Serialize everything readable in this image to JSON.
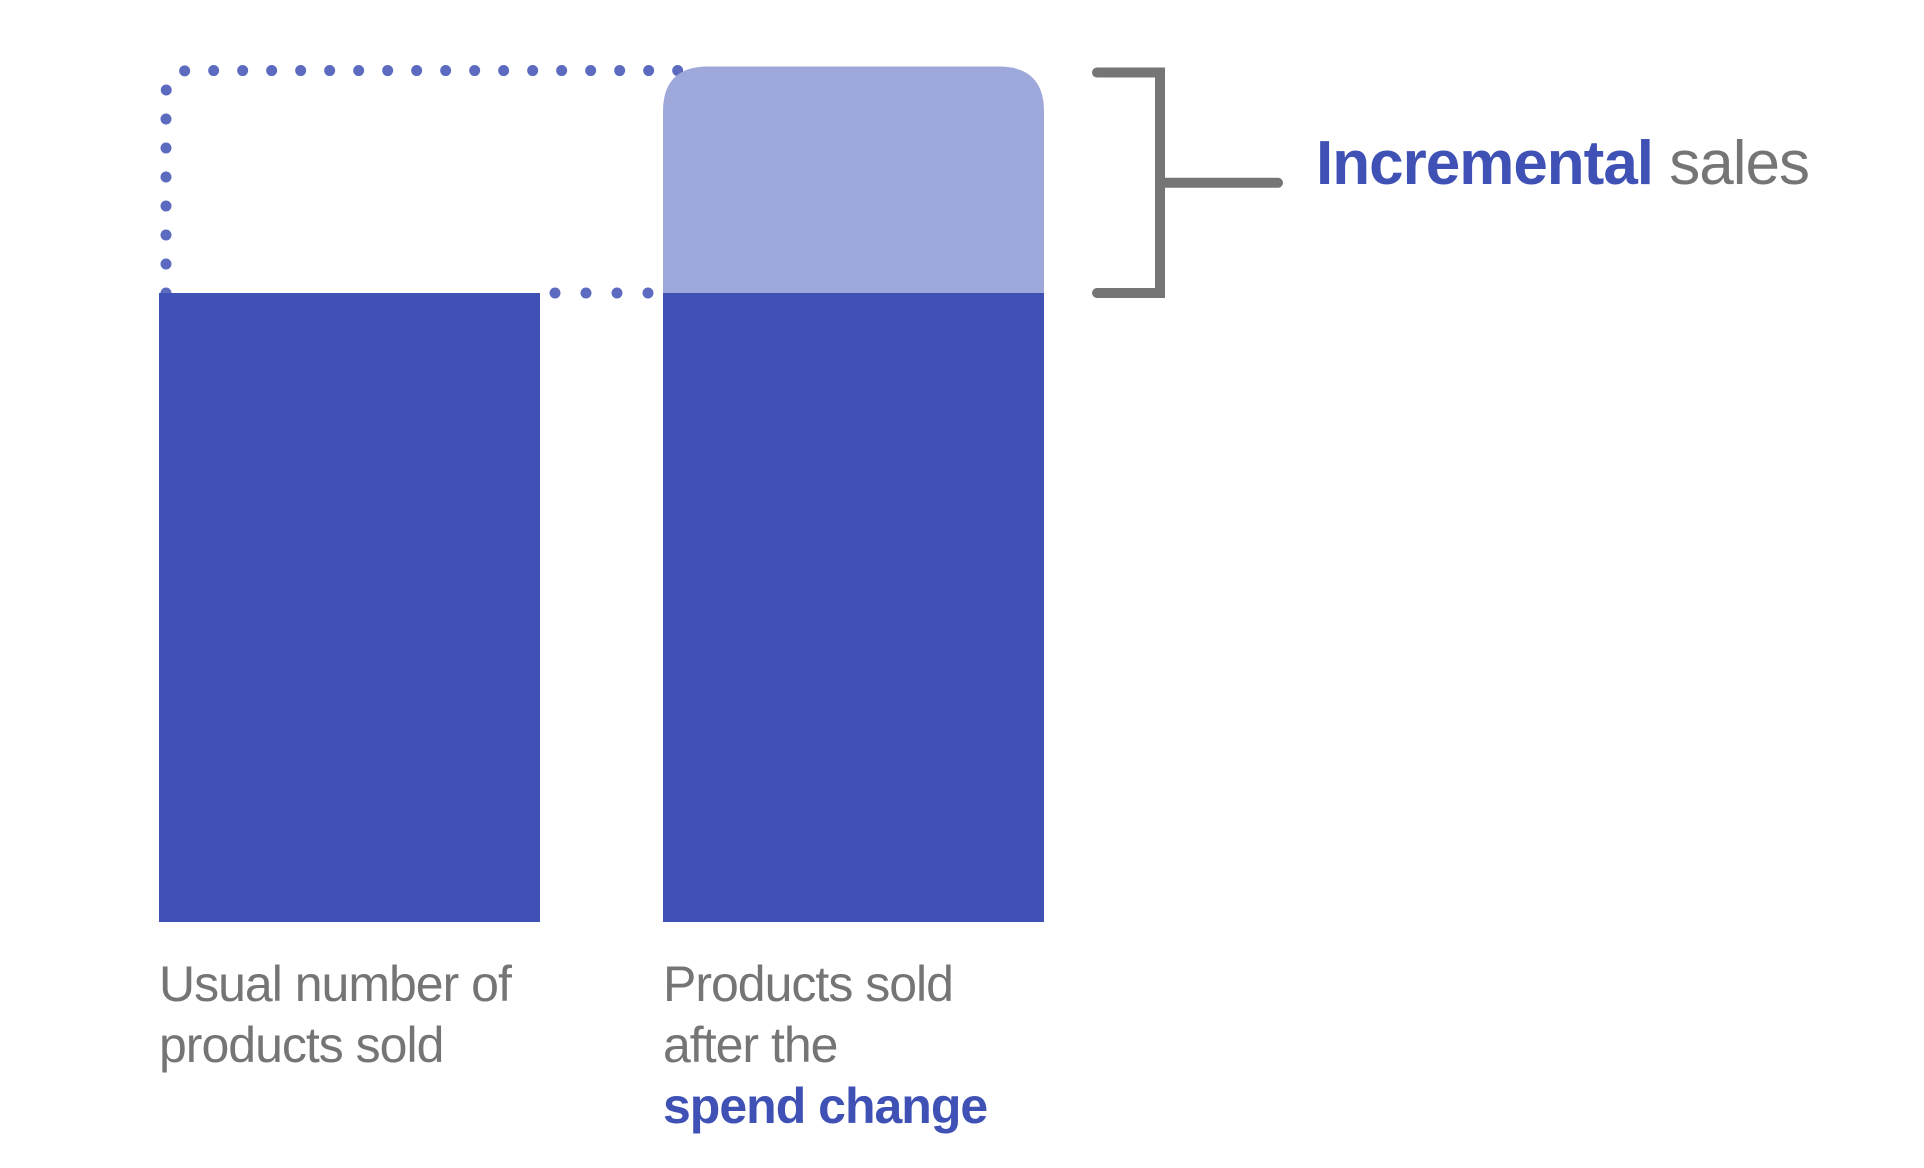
{
  "colors": {
    "base_bar": "#3f51b5",
    "incremental_segment": "#9fa8da",
    "dotted_outline": "#5c6bc0",
    "bracket": "#757575",
    "label_text": "#757575",
    "accent_text": "#3f51b5"
  },
  "chart_data": {
    "type": "bar",
    "stacked": true,
    "axes_shown": false,
    "grid": false,
    "categories": [
      "Usual number of products sold",
      "Products sold after the spend change"
    ],
    "series": [
      {
        "name": "",
        "values": [
          100,
          100
        ]
      },
      {
        "name": "",
        "values": [
          0,
          36
        ]
      }
    ],
    "annotation": {
      "highlight": "Incremental",
      "rest": "sales"
    },
    "category_labels": [
      {
        "lines": [
          "Usual number of",
          "products sold"
        ],
        "highlight": ""
      },
      {
        "lines": [
          "Products sold",
          "after the"
        ],
        "highlight": "spend change"
      }
    ]
  }
}
